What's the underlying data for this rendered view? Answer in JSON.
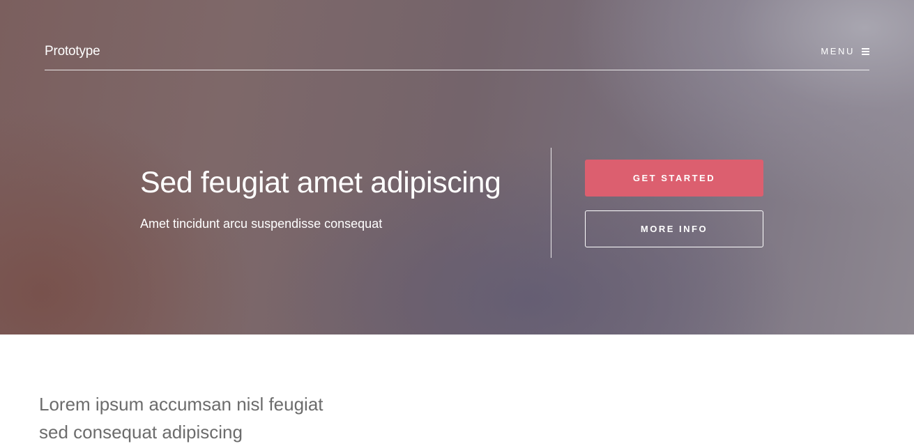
{
  "nav": {
    "brand": "Prototype",
    "menu_label": "MENU",
    "menu_icon": "hamburger-icon"
  },
  "hero": {
    "title": "Sed feugiat amet adipiscing",
    "subtitle": "Amet tincidunt arcu suspendisse consequat",
    "primary_button": "GET STARTED",
    "secondary_button": "MORE INFO"
  },
  "intro": {
    "line1": "Lorem ipsum accumsan nisl feugiat",
    "line2": "sed consequat adipiscing"
  },
  "colors": {
    "accent": "#dc5f6f",
    "text_light": "#ffffff",
    "text_muted": "#6c6c6c"
  }
}
